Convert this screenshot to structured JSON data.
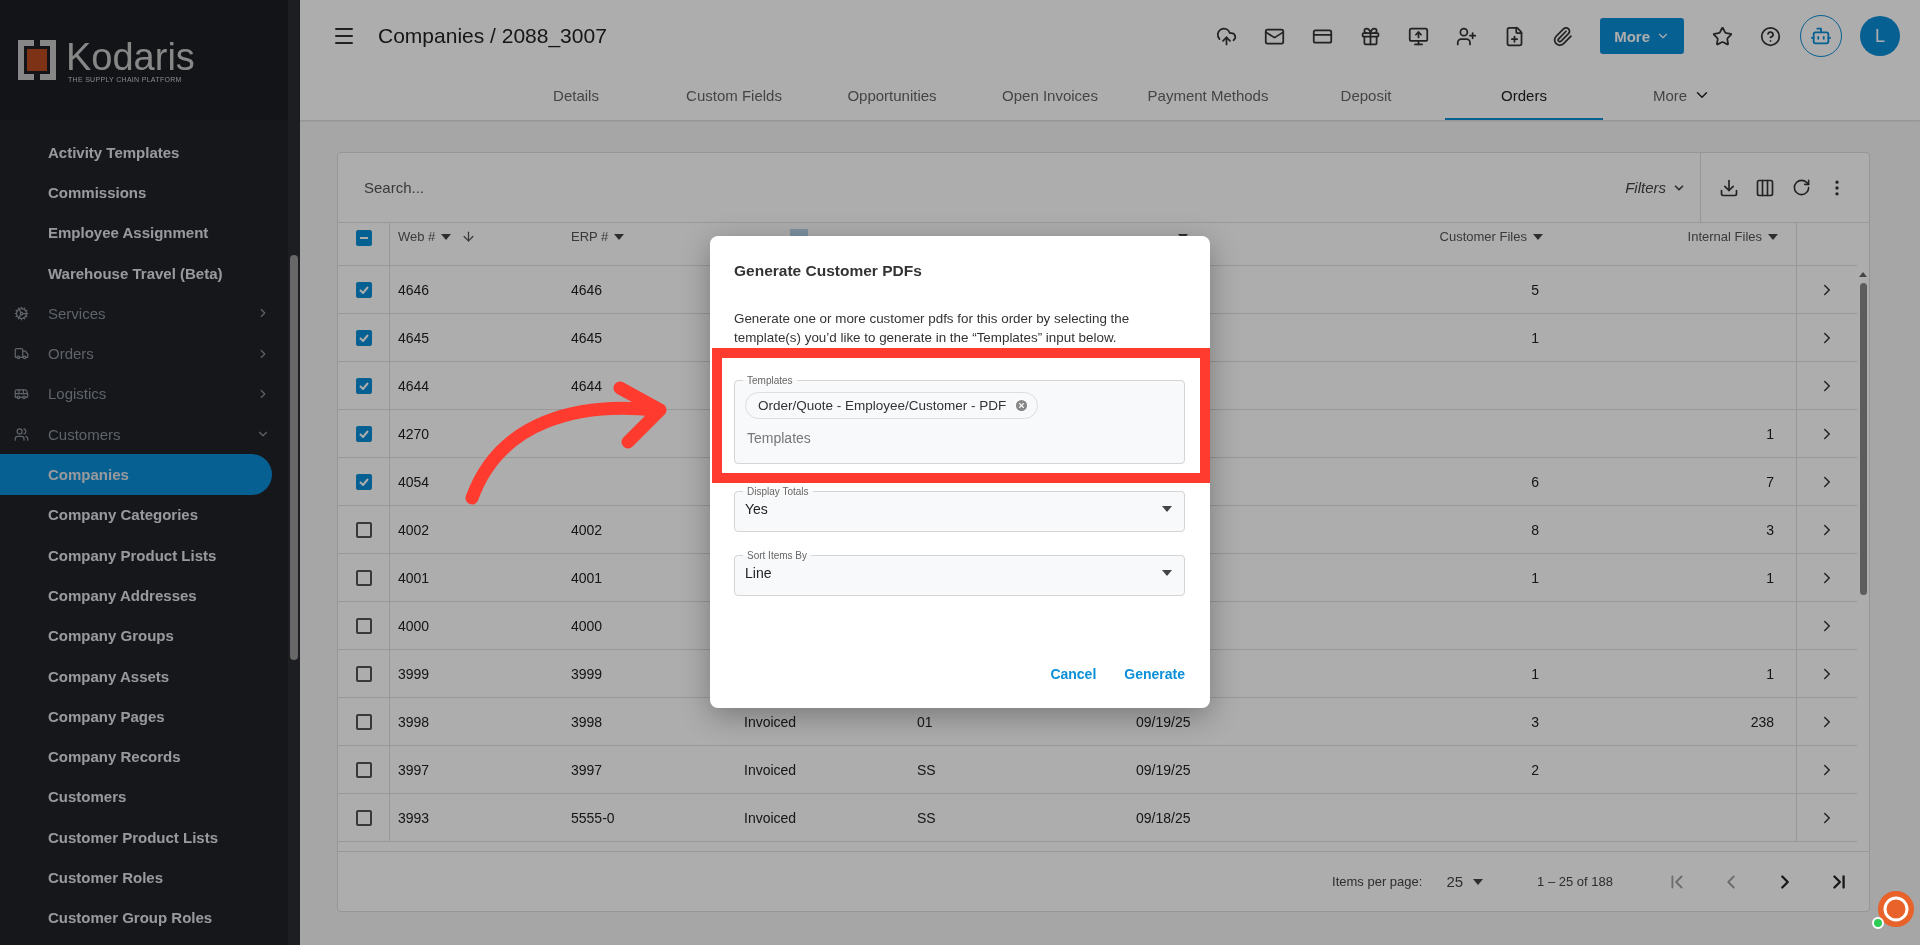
{
  "logo": {
    "name": "Kodaris",
    "tagline": "THE SUPPLY CHAIN PLATFORM"
  },
  "sidebar": {
    "items": [
      {
        "kind": "link",
        "label": "Activity Templates",
        "selected": false
      },
      {
        "kind": "link",
        "label": "Commissions",
        "selected": false
      },
      {
        "kind": "link",
        "label": "Employee Assignment",
        "selected": false
      },
      {
        "kind": "link",
        "label": "Warehouse Travel (Beta)",
        "selected": false
      },
      {
        "kind": "group",
        "label": "Services",
        "expanded": false
      },
      {
        "kind": "group",
        "label": "Orders",
        "expanded": false
      },
      {
        "kind": "group",
        "label": "Logistics",
        "expanded": false
      },
      {
        "kind": "group",
        "label": "Customers",
        "expanded": true,
        "children": [
          {
            "kind": "link",
            "label": "Companies",
            "selected": true
          },
          {
            "kind": "link",
            "label": "Company Categories",
            "selected": false
          },
          {
            "kind": "link",
            "label": "Company Product Lists",
            "selected": false
          },
          {
            "kind": "link",
            "label": "Company Addresses",
            "selected": false
          },
          {
            "kind": "link",
            "label": "Company Groups",
            "selected": false
          },
          {
            "kind": "link",
            "label": "Company Assets",
            "selected": false
          },
          {
            "kind": "link",
            "label": "Company Pages",
            "selected": false
          },
          {
            "kind": "link",
            "label": "Company Records",
            "selected": false
          },
          {
            "kind": "link",
            "label": "Customers",
            "selected": false
          },
          {
            "kind": "link",
            "label": "Customer Product Lists",
            "selected": false
          },
          {
            "kind": "link",
            "label": "Customer Roles",
            "selected": false
          },
          {
            "kind": "link",
            "label": "Customer Group Roles",
            "selected": false
          }
        ]
      }
    ]
  },
  "header": {
    "title": "Companies / 2088_3007",
    "more_button": "More",
    "avatar": "L"
  },
  "tabs": [
    {
      "label": "Details",
      "selected": false
    },
    {
      "label": "Custom Fields",
      "selected": false
    },
    {
      "label": "Opportunities",
      "selected": false
    },
    {
      "label": "Open Invoices",
      "selected": false
    },
    {
      "label": "Payment Methods",
      "selected": false
    },
    {
      "label": "Deposit",
      "selected": false
    },
    {
      "label": "Orders",
      "selected": true
    },
    {
      "label": "More",
      "selected": false,
      "kind": "dropdown"
    }
  ],
  "toolbar": {
    "search_placeholder": "Search...",
    "filters": "Filters"
  },
  "table": {
    "select_all": {
      "indeterminate": true
    },
    "columns": [
      {
        "label": "Web #",
        "caret": true,
        "sorted": true,
        "filter_badge": false
      },
      {
        "label": "ERP #",
        "caret": true,
        "sorted": false,
        "filter_badge": false
      },
      {
        "caret": false,
        "sorted": false,
        "filter_badge": true
      },
      {
        "caret": false,
        "sorted": false,
        "filter_badge": false
      },
      {
        "caret": true,
        "sorted": false,
        "filter_badge": false
      },
      {
        "label": "Customer Files",
        "caret": true,
        "sorted": false,
        "filter_badge": false
      },
      {
        "label": "Internal Files",
        "caret": true,
        "sorted": false,
        "filter_badge": false
      }
    ],
    "rows": [
      {
        "checked": true,
        "web": "4646",
        "erp": "4646",
        "customer_files": "5"
      },
      {
        "checked": true,
        "web": "4645",
        "erp": "4645",
        "customer_files": "1"
      },
      {
        "checked": true,
        "web": "4644",
        "erp": "4644"
      },
      {
        "checked": true,
        "web": "4270",
        "internal_files": "1"
      },
      {
        "checked": true,
        "web": "4054",
        "customer_files": "6",
        "internal_files": "7"
      },
      {
        "checked": false,
        "web": "4002",
        "erp": "4002",
        "customer_files": "8",
        "internal_files": "3"
      },
      {
        "checked": false,
        "web": "4001",
        "erp": "4001",
        "customer_files": "1",
        "internal_files": "1"
      },
      {
        "checked": false,
        "web": "4000",
        "erp": "4000"
      },
      {
        "checked": false,
        "web": "3999",
        "erp": "3999",
        "customer_files": "1",
        "internal_files": "1"
      },
      {
        "checked": false,
        "web": "3998",
        "erp": "3998",
        "status": "Invoiced",
        "warehouse": "01",
        "completed": "09/19/25",
        "customer_files": "3",
        "internal_files": "238"
      },
      {
        "checked": false,
        "web": "3997",
        "erp": "3997",
        "status": "Invoiced",
        "warehouse": "SS",
        "completed": "09/19/25",
        "customer_files": "2"
      },
      {
        "checked": false,
        "web": "3993",
        "erp": "5555-0",
        "status": "Invoiced",
        "warehouse": "SS",
        "completed": "09/18/25"
      }
    ]
  },
  "pagination": {
    "items_per_page_label": "Items per page:",
    "items_per_page": "25",
    "range": "1 – 25 of 188",
    "buttons": [
      {
        "kind": "first",
        "disabled": true
      },
      {
        "kind": "prev",
        "disabled": true
      },
      {
        "kind": "next",
        "disabled": false
      },
      {
        "kind": "last",
        "disabled": false
      }
    ]
  },
  "dialog": {
    "title": "Generate Customer PDFs",
    "description": "Generate one or more customer pdfs for this order by selecting the template(s) you’d like to generate in the “Templates” input below.",
    "templates": {
      "label": "Templates",
      "chips": [
        "Order/Quote - Employee/Customer - PDF"
      ],
      "placeholder": "Templates",
      "highlighted": true
    },
    "selects": [
      {
        "label": "Display Totals",
        "value": "Yes"
      },
      {
        "label": "Sort Items By",
        "value": "Line"
      }
    ],
    "buttons": [
      "Cancel",
      "Generate"
    ]
  }
}
